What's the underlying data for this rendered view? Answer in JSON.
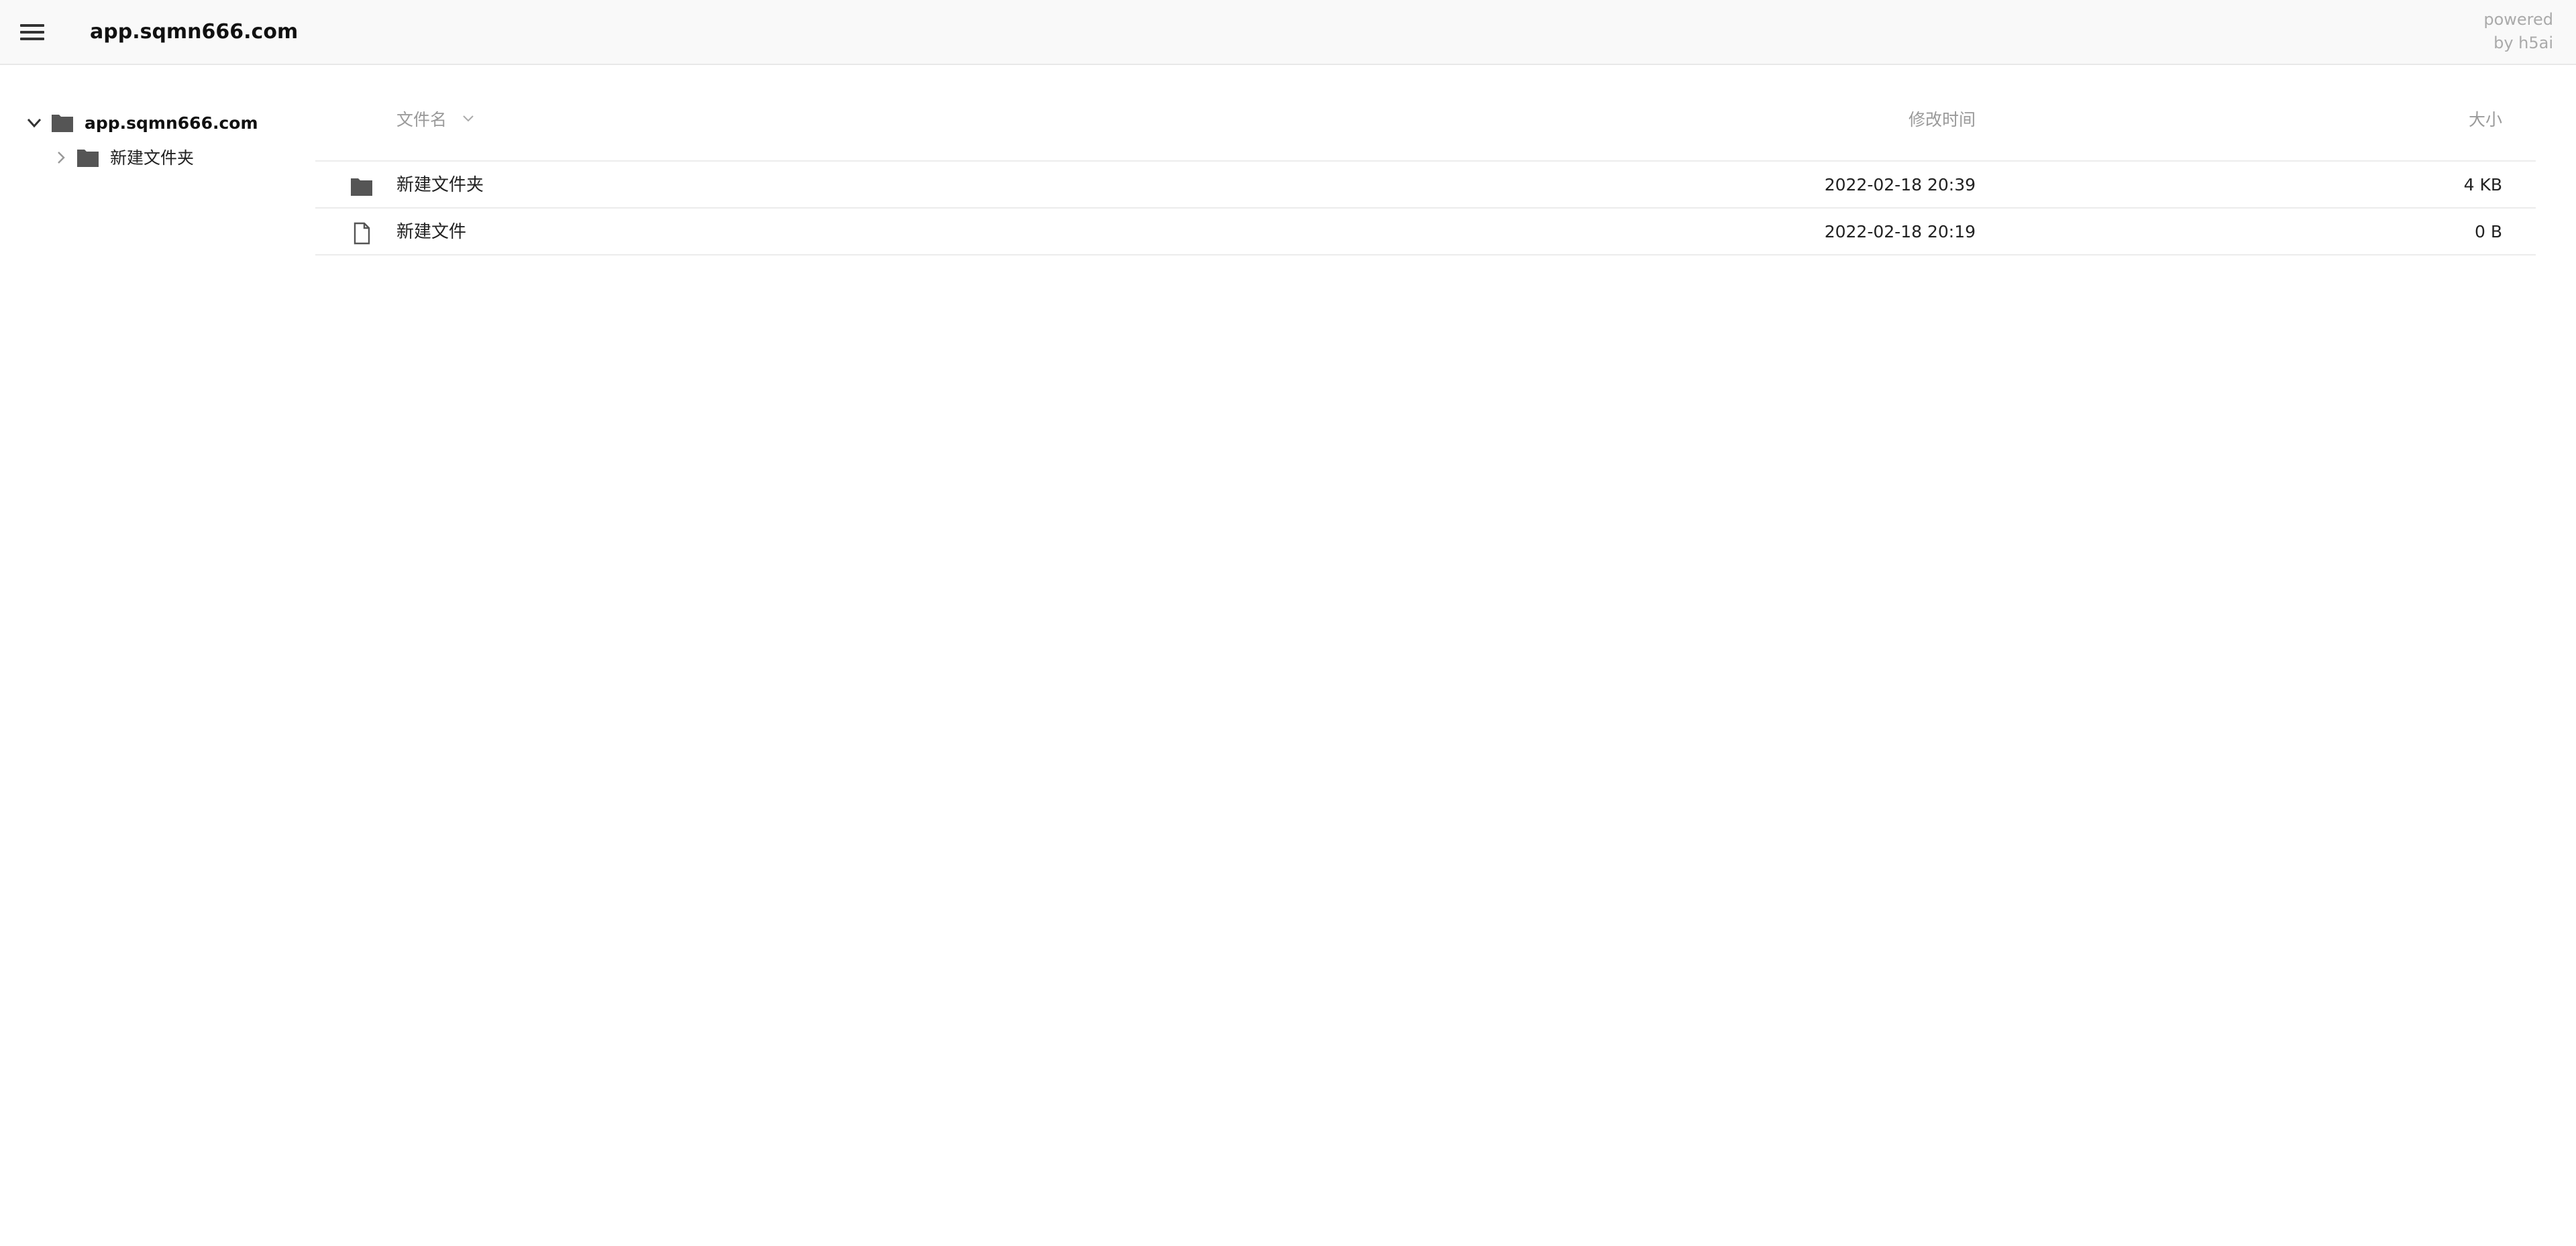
{
  "header": {
    "title": "app.sqmn666.com",
    "powered_line1": "powered",
    "powered_line2": "by h5ai",
    "menu_icon": "hamburger-menu-icon"
  },
  "sidebar": {
    "root": {
      "label": "app.sqmn666.com",
      "expanded": true,
      "icon": "folder-icon"
    },
    "children": [
      {
        "label": "新建文件夹",
        "expanded": false,
        "icon": "folder-icon"
      }
    ]
  },
  "list": {
    "columns": {
      "name": "文件名",
      "modified": "修改时间",
      "size": "大小"
    },
    "rows": [
      {
        "type": "folder",
        "icon": "folder-icon",
        "name": "新建文件夹",
        "modified": "2022-02-18 20:39",
        "size": "4 KB"
      },
      {
        "type": "file",
        "icon": "file-icon",
        "name": "新建文件",
        "modified": "2022-02-18 20:19",
        "size": "0 B"
      }
    ]
  },
  "colors": {
    "header_bg": "#f9f9f9",
    "icon": "#555555",
    "muted_text": "#9a9a9a",
    "divider": "#ececec"
  }
}
